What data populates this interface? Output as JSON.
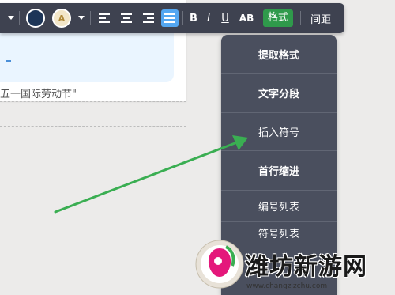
{
  "document": {
    "quote_text": "五一国际劳动节\""
  },
  "toolbar": {
    "text_color": "#1d3557",
    "bold_label": "B",
    "italic_label": "I",
    "underline_label": "U",
    "strike_label": "AB",
    "format_label": "格式",
    "spacing_label": "间距",
    "bg_color_letter": "A"
  },
  "menu": {
    "items": [
      {
        "label": "提取格式"
      },
      {
        "label": "文字分段"
      },
      {
        "label": "插入符号"
      },
      {
        "label": "首行缩进"
      },
      {
        "label": "编号列表"
      },
      {
        "label": "符号列表"
      }
    ]
  },
  "watermark": {
    "title": "潍坊新游网",
    "url": "www.changzizchu.com"
  },
  "colors": {
    "toolbar_bg": "#3e4250",
    "menu_bg": "#4a4f5e",
    "accent_blue": "#54a7f1",
    "format_green": "#2f9a4b",
    "arrow_green": "#3aae52"
  }
}
